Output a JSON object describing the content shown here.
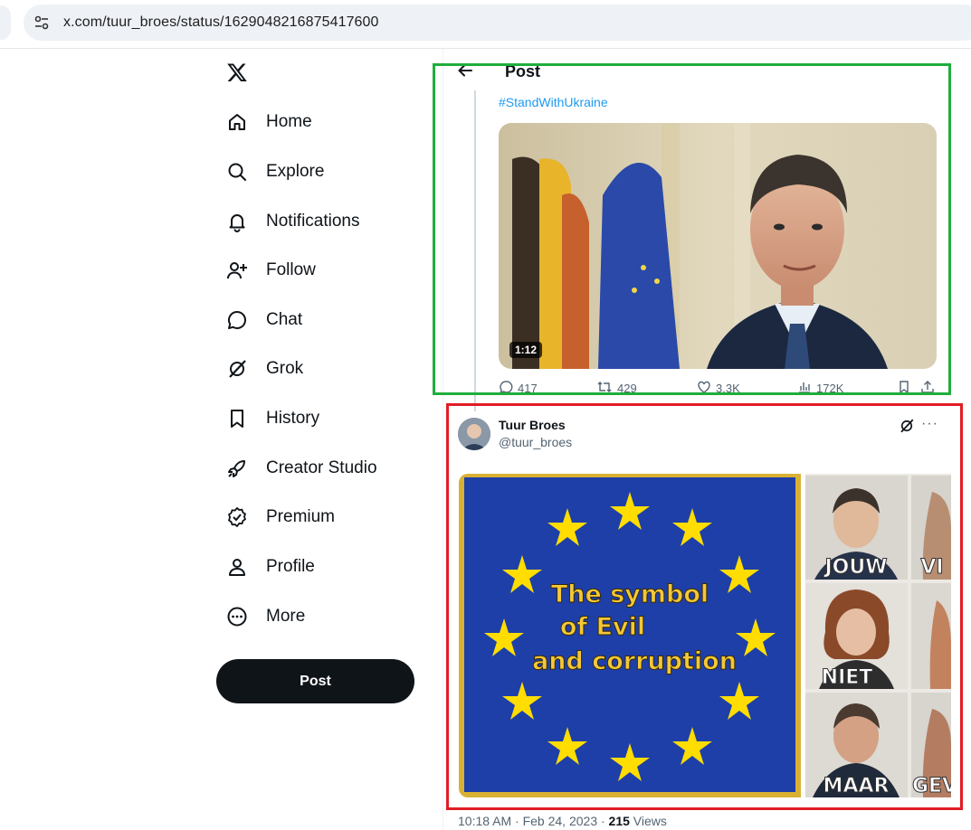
{
  "browser": {
    "url": "x.com/tuur_broes/status/1629048216875417600"
  },
  "nav": {
    "items": [
      {
        "label": "Home",
        "icon": "home-icon"
      },
      {
        "label": "Explore",
        "icon": "search-icon"
      },
      {
        "label": "Notifications",
        "icon": "bell-icon"
      },
      {
        "label": "Follow",
        "icon": "person-plus-icon"
      },
      {
        "label": "Chat",
        "icon": "chat-bubble-icon"
      },
      {
        "label": "Grok",
        "icon": "grok-icon"
      },
      {
        "label": "History",
        "icon": "bookmark-icon"
      },
      {
        "label": "Creator Studio",
        "icon": "rocket-icon"
      },
      {
        "label": "Premium",
        "icon": "verified-badge-icon"
      },
      {
        "label": "Profile",
        "icon": "person-icon"
      },
      {
        "label": "More",
        "icon": "more-circle-icon"
      }
    ],
    "post_button": "Post"
  },
  "header": {
    "title": "Post"
  },
  "tweet1": {
    "hashtag": "#StandWithUkraine",
    "video_duration": "1:12",
    "replies": "417",
    "reposts": "429",
    "likes": "3.3K",
    "views": "172K"
  },
  "tweet2": {
    "author_name": "Tuur Broes",
    "author_handle": "@tuur_broes",
    "image1_text_line1": "The symbol",
    "image1_text_line2": "of Evil",
    "image1_text_line3": "and corruption",
    "image2_labels": [
      "JOUW",
      "VI",
      "NIET",
      "MAAR",
      "GEV"
    ],
    "timestamp": "10:18 AM · Feb 24, 2023 · ",
    "views_count": "215",
    "views_label": " Views"
  },
  "colors": {
    "accent": "#1d9bf0",
    "highlight_green": "#1fae3c",
    "highlight_red": "#e11d24",
    "eu_blue": "#1e3fa8",
    "eu_star": "#ffdd00"
  }
}
